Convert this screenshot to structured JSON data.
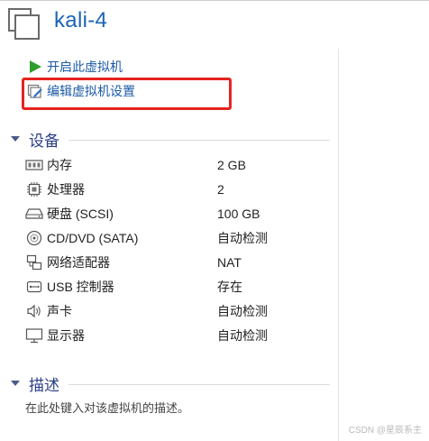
{
  "vm": {
    "name": "kali-4"
  },
  "actions": [
    {
      "label": "开启此虚拟机",
      "icon": "play-icon"
    },
    {
      "label": "编辑虚拟机设置",
      "icon": "edit-settings-icon"
    }
  ],
  "devices_section": {
    "title": "设备"
  },
  "devices": [
    {
      "name": "内存",
      "value": "2 GB",
      "icon": "memory-icon"
    },
    {
      "name": "处理器",
      "value": "2",
      "icon": "processor-icon"
    },
    {
      "name": "硬盘 (SCSI)",
      "value": "100 GB",
      "icon": "hard-disk-icon"
    },
    {
      "name": "CD/DVD (SATA)",
      "value": "自动检测",
      "icon": "cd-dvd-icon"
    },
    {
      "name": "网络适配器",
      "value": "NAT",
      "icon": "network-adapter-icon"
    },
    {
      "name": "USB 控制器",
      "value": "存在",
      "icon": "usb-icon"
    },
    {
      "name": "声卡",
      "value": "自动检测",
      "icon": "speaker-icon"
    },
    {
      "name": "显示器",
      "value": "自动检测",
      "icon": "monitor-icon"
    }
  ],
  "description_section": {
    "title": "描述",
    "placeholder": "在此处键入对该虚拟机的描述。"
  },
  "watermark": "CSDN @星辰系主",
  "colors": {
    "title": "#1b63b7",
    "section": "#2a3e86",
    "link": "#1a5aa6",
    "highlight": "#e6231f",
    "play": "#2e9d2e"
  }
}
